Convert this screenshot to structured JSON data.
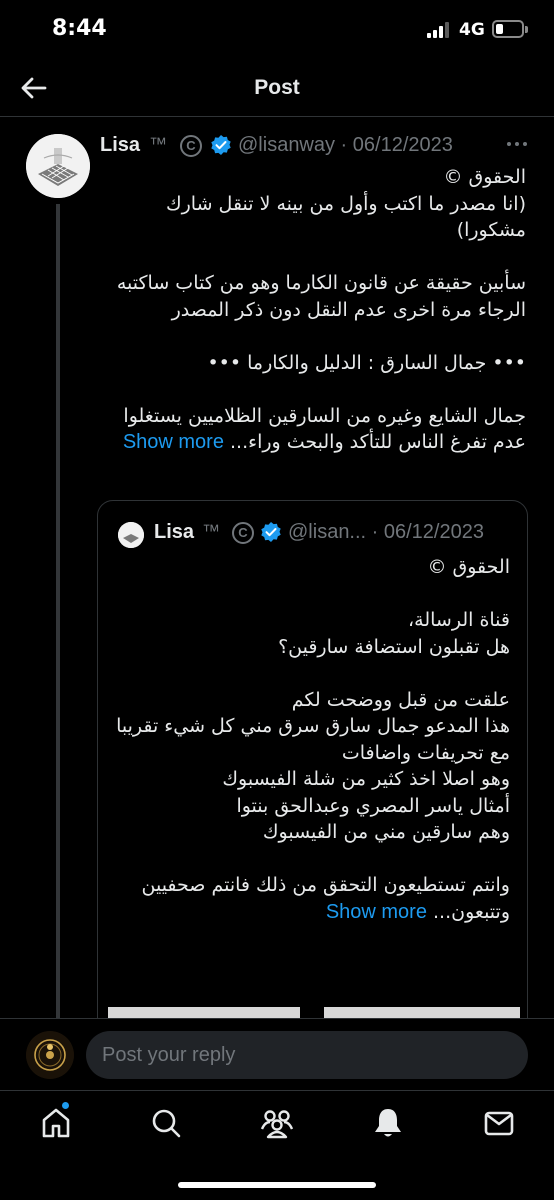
{
  "status_bar": {
    "time": "8:44",
    "network": "4G",
    "battery_level": 0.3
  },
  "header": {
    "title": "Post",
    "back_icon": "arrow-left-icon"
  },
  "post": {
    "author": "Lisa",
    "tm": "™",
    "copyright": "C",
    "handle": "@lisanway · 06/12/2023",
    "text": "الحقوق ©\n(انا مصدر ما اكتب وأول من بينه لا تنقل شارك مشكورا)\n\nسأبين حقيقة عن قانون الكارما وهو من كتاب ساكتبه الرجاء مرة اخرى عدم النقل دون ذكر المصدر\n\n••• جمال السارق : الدليل والكارما •••\n\nجمال الشايع وغيره من السارقين الظلاميين يستغلوا عدم تفرغ الناس للتأكد والبحث وراء...",
    "show_more": "Show more"
  },
  "quote": {
    "author": "Lisa",
    "tm": "™",
    "copyright": "C",
    "handle": "@lisan... · 06/12/2023",
    "text": "الحقوق ©\n\nقناة الرسالة،\nهل تقبلون استضافة سارقين؟\n\nعلقت من قبل ووضحت لكم\nهذا المدعو جمال سارق سرق مني كل شيء تقريبا\nمع تحريفات واضافات\nوهو اصلا اخذ كثير من شلة الفيسبوك\nأمثال ياسر المصري وعبدالحق بنتوا\nوهم سارقين مني من الفيسبوك\n\nوانتم تستطيعون التحقق من ذلك فانتم صحفيين\nوتتبعون...",
    "show_more": "Show more"
  },
  "reply": {
    "placeholder": "Post your reply"
  },
  "tab_bar": {
    "items": [
      "home-icon",
      "search-icon",
      "communities-icon",
      "notifications-icon",
      "messages-icon"
    ],
    "accent": "#1d9bf0"
  }
}
